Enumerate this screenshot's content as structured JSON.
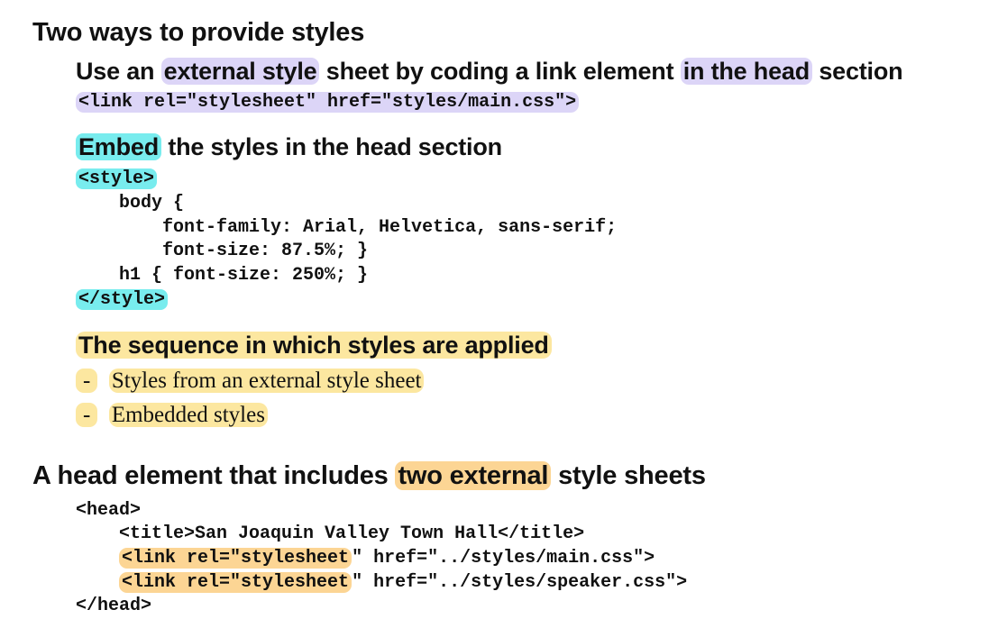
{
  "section1": {
    "heading": "Two ways to provide styles",
    "external": {
      "pre": "Use an ",
      "highlight1": "external style",
      "mid": " sheet by coding a link element ",
      "highlight2": "in the head",
      "post": " section",
      "code": "<link rel=\"stylesheet\" href=\"styles/main.css\">"
    },
    "embed": {
      "highlight": "Embed",
      "rest": " the styles in the head section",
      "code_lines": [
        "<style>",
        "    body {",
        "        font-family: Arial, Helvetica, sans-serif;",
        "        font-size: 87.5%; }",
        "    h1 { font-size: 250%; }",
        "</style>"
      ]
    },
    "sequence": {
      "heading": "The sequence in which styles are applied",
      "bullet": "-",
      "items": [
        "Styles from an external style sheet",
        "Embedded styles"
      ]
    }
  },
  "section2": {
    "heading_pre": "A head element that includes ",
    "heading_highlight": "two external",
    "heading_post": " style sheets",
    "code": {
      "line1": "<head>",
      "line2": "    <title>San Joaquin Valley Town Hall</title>",
      "line3_indent": "    ",
      "line3_hl": "<link rel=\"stylesheet",
      "line3_rest": "\" href=\"../styles/main.css\">",
      "line4_indent": "    ",
      "line4_hl": "<link rel=\"stylesheet",
      "line4_rest": "\" href=\"../styles/speaker.css\">",
      "line5": "</head>"
    }
  },
  "colors": {
    "purple_highlight": "#dcd5f7",
    "cyan_highlight": "#78ecee",
    "yellow_highlight": "#fce7a0",
    "orange_highlight": "#fcd594"
  }
}
